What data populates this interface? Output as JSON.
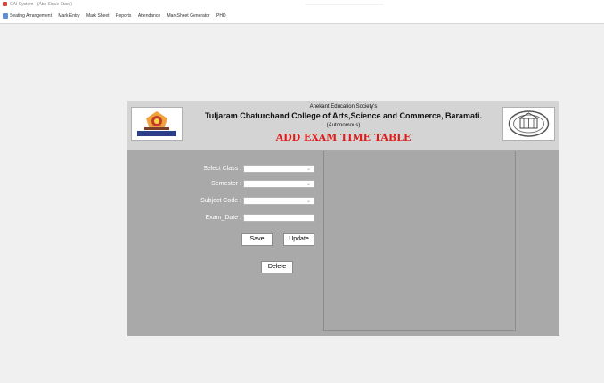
{
  "window": {
    "title": "CAI System - (Abc Sinue Stars)"
  },
  "menu": {
    "items": [
      "Seating Arrangement",
      "Mark Entry",
      "Mark Sheet",
      "Reports",
      "Attendance",
      "MarkSheet Generator",
      "PHD"
    ]
  },
  "header": {
    "society": "Anekant Education Society's",
    "college": "Tuljaram Chaturchand College of Arts,Science and Commerce, Baramati.",
    "autonomous": "(Autonomous)",
    "form_title": "ADD EXAM TIME TABLE"
  },
  "form": {
    "select_class_label": "Select Class :",
    "semester_label": "Semester :",
    "subject_code_label": "Subject Code :",
    "exam_date_label": "Exam_Date :",
    "select_class_value": "",
    "semester_value": "",
    "subject_code_value": "",
    "exam_date_value": ""
  },
  "buttons": {
    "save": "Save",
    "update": "Update",
    "delete": "Delete"
  }
}
